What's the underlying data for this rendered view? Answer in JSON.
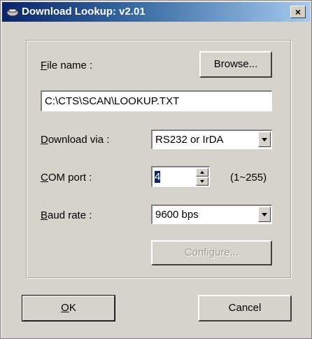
{
  "window": {
    "title": "Download Lookup: v2.01",
    "close_label": "×"
  },
  "file": {
    "label_mnemonic": "F",
    "label_rest": "ile name :",
    "browse_label": "Browse...",
    "path_value": "C:\\CTS\\SCAN\\LOOKUP.TXT"
  },
  "download": {
    "label_mnemonic": "D",
    "label_rest": "ownload via :",
    "selected": "RS232 or IrDA"
  },
  "com": {
    "label_mnemonic": "C",
    "label_rest": "OM port :",
    "value": "4",
    "range_hint": "(1~255)"
  },
  "baud": {
    "label_mnemonic": "B",
    "label_rest": "aud rate :",
    "selected": "9600 bps"
  },
  "configure": {
    "label": "Configure..."
  },
  "footer": {
    "ok_mnemonic": "O",
    "ok_rest": "K",
    "cancel_label": "Cancel"
  }
}
